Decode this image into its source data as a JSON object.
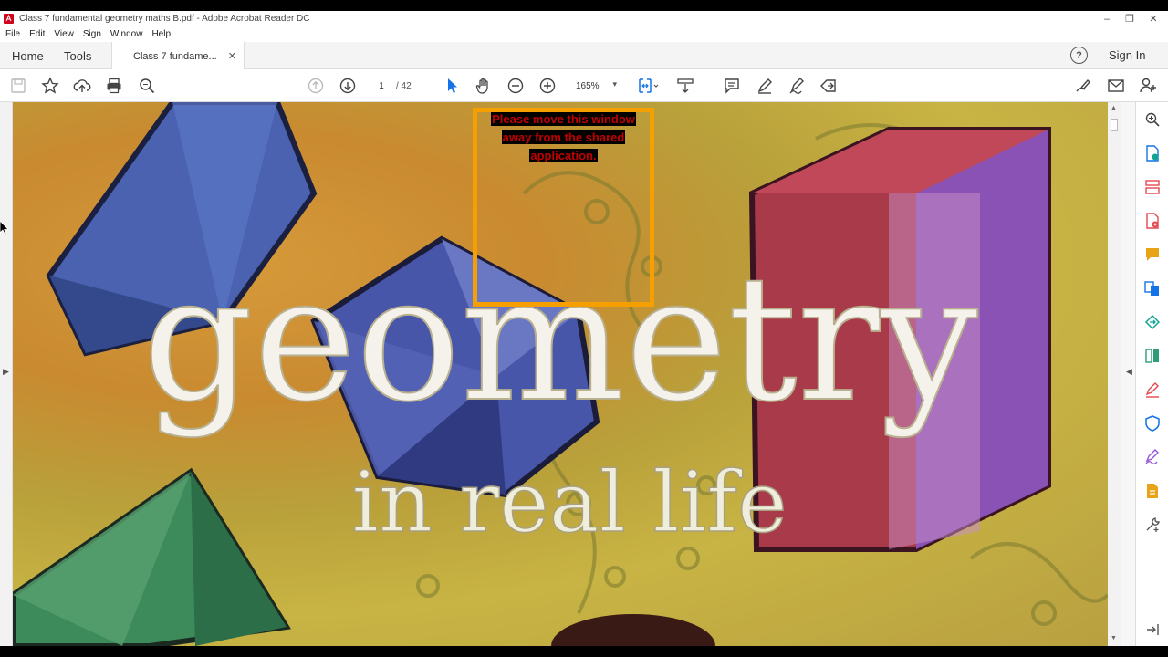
{
  "window": {
    "title": "Class 7 fundamental geometry maths B.pdf - Adobe Acrobat Reader DC"
  },
  "menu": [
    "File",
    "Edit",
    "View",
    "Sign",
    "Window",
    "Help"
  ],
  "tabs": {
    "home": "Home",
    "tools": "Tools",
    "document": "Class 7 fundame..."
  },
  "header": {
    "signin": "Sign In",
    "help": "?"
  },
  "toolbar": {
    "current_page": "1",
    "page_separator": "/ 42",
    "zoom": "165%"
  },
  "overlay": {
    "warning_lines": [
      "Please move this window",
      "away from the shared",
      "application."
    ],
    "box_color": "#f5a000",
    "text_color": "#c00000"
  },
  "document": {
    "headline": "geometry",
    "subheadline": "in real life"
  },
  "icons": {
    "save": "save-icon",
    "bookmark": "star-icon",
    "upload": "cloud-upload-icon",
    "print": "print-icon",
    "search": "search-icon",
    "prev": "arrow-up-circle-icon",
    "next": "arrow-down-circle-icon",
    "select": "pointer-icon",
    "hand": "hand-icon",
    "zoom_out": "minus-circle-icon",
    "zoom_in": "plus-circle-icon"
  },
  "colors": {
    "accent": "#1473e6",
    "panel_icons": [
      "#1473e6",
      "#e34850",
      "#e34850",
      "#e8a317",
      "#1473e6",
      "#12a594",
      "#2d9d78",
      "#e34850",
      "#1473e6",
      "#9256d9",
      "#e8a317",
      "#555555"
    ]
  }
}
